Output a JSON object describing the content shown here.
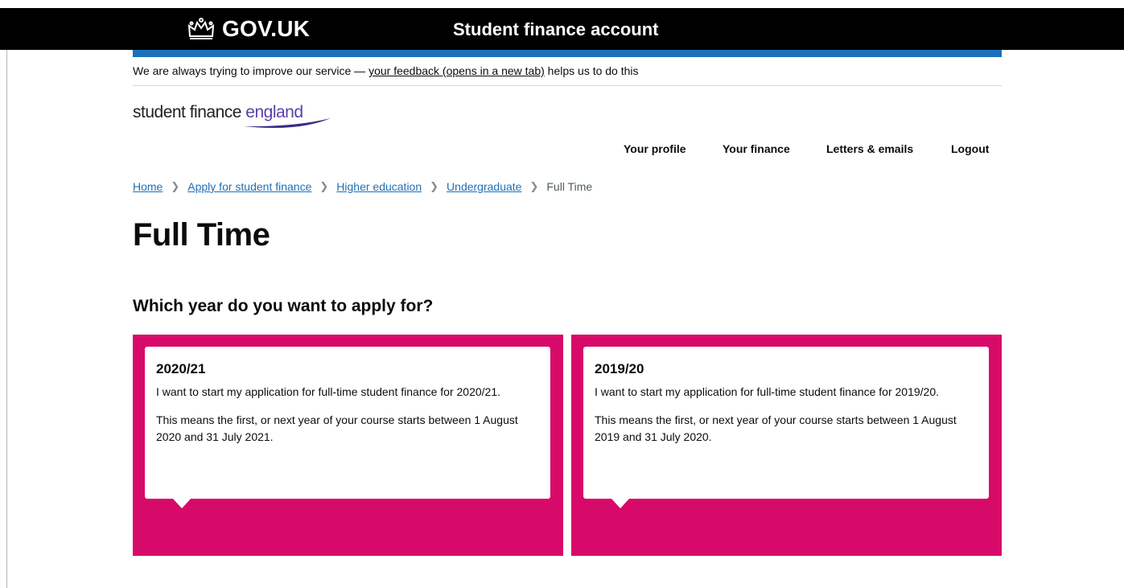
{
  "header": {
    "gov_logo_text": "GOV.UK",
    "service_name": "Student finance account"
  },
  "feedback": {
    "prefix": "We are always trying to improve our service — ",
    "link_text": "your feedback (opens in a new tab)",
    "suffix": " helps us to do this"
  },
  "logo": {
    "part1": "student finance ",
    "part2": "england"
  },
  "nav": {
    "items": [
      "Your profile",
      "Your finance",
      "Letters & emails",
      "Logout"
    ]
  },
  "breadcrumbs": {
    "links": [
      "Home",
      "Apply for student finance",
      "Higher education",
      "Undergraduate"
    ],
    "current": "Full Time"
  },
  "page_title": "Full Time",
  "question": "Which year do you want to apply for?",
  "cards": [
    {
      "year": "2020/21",
      "description": "I want to start my application for full-time student finance for 2020/21.",
      "details": "This means the first, or next year of your course starts between 1 August 2020 and 31 July 2021."
    },
    {
      "year": "2019/20",
      "description": "I want to start my application for full-time student finance for 2019/20.",
      "details": "This means the first, or next year of your course starts between 1 August 2019 and 31 July 2020."
    }
  ],
  "colors": {
    "header_bg": "#000000",
    "accent_blue": "#1d70b8",
    "card_pink": "#d70a6a",
    "logo_purple": "#5a3fa6"
  }
}
